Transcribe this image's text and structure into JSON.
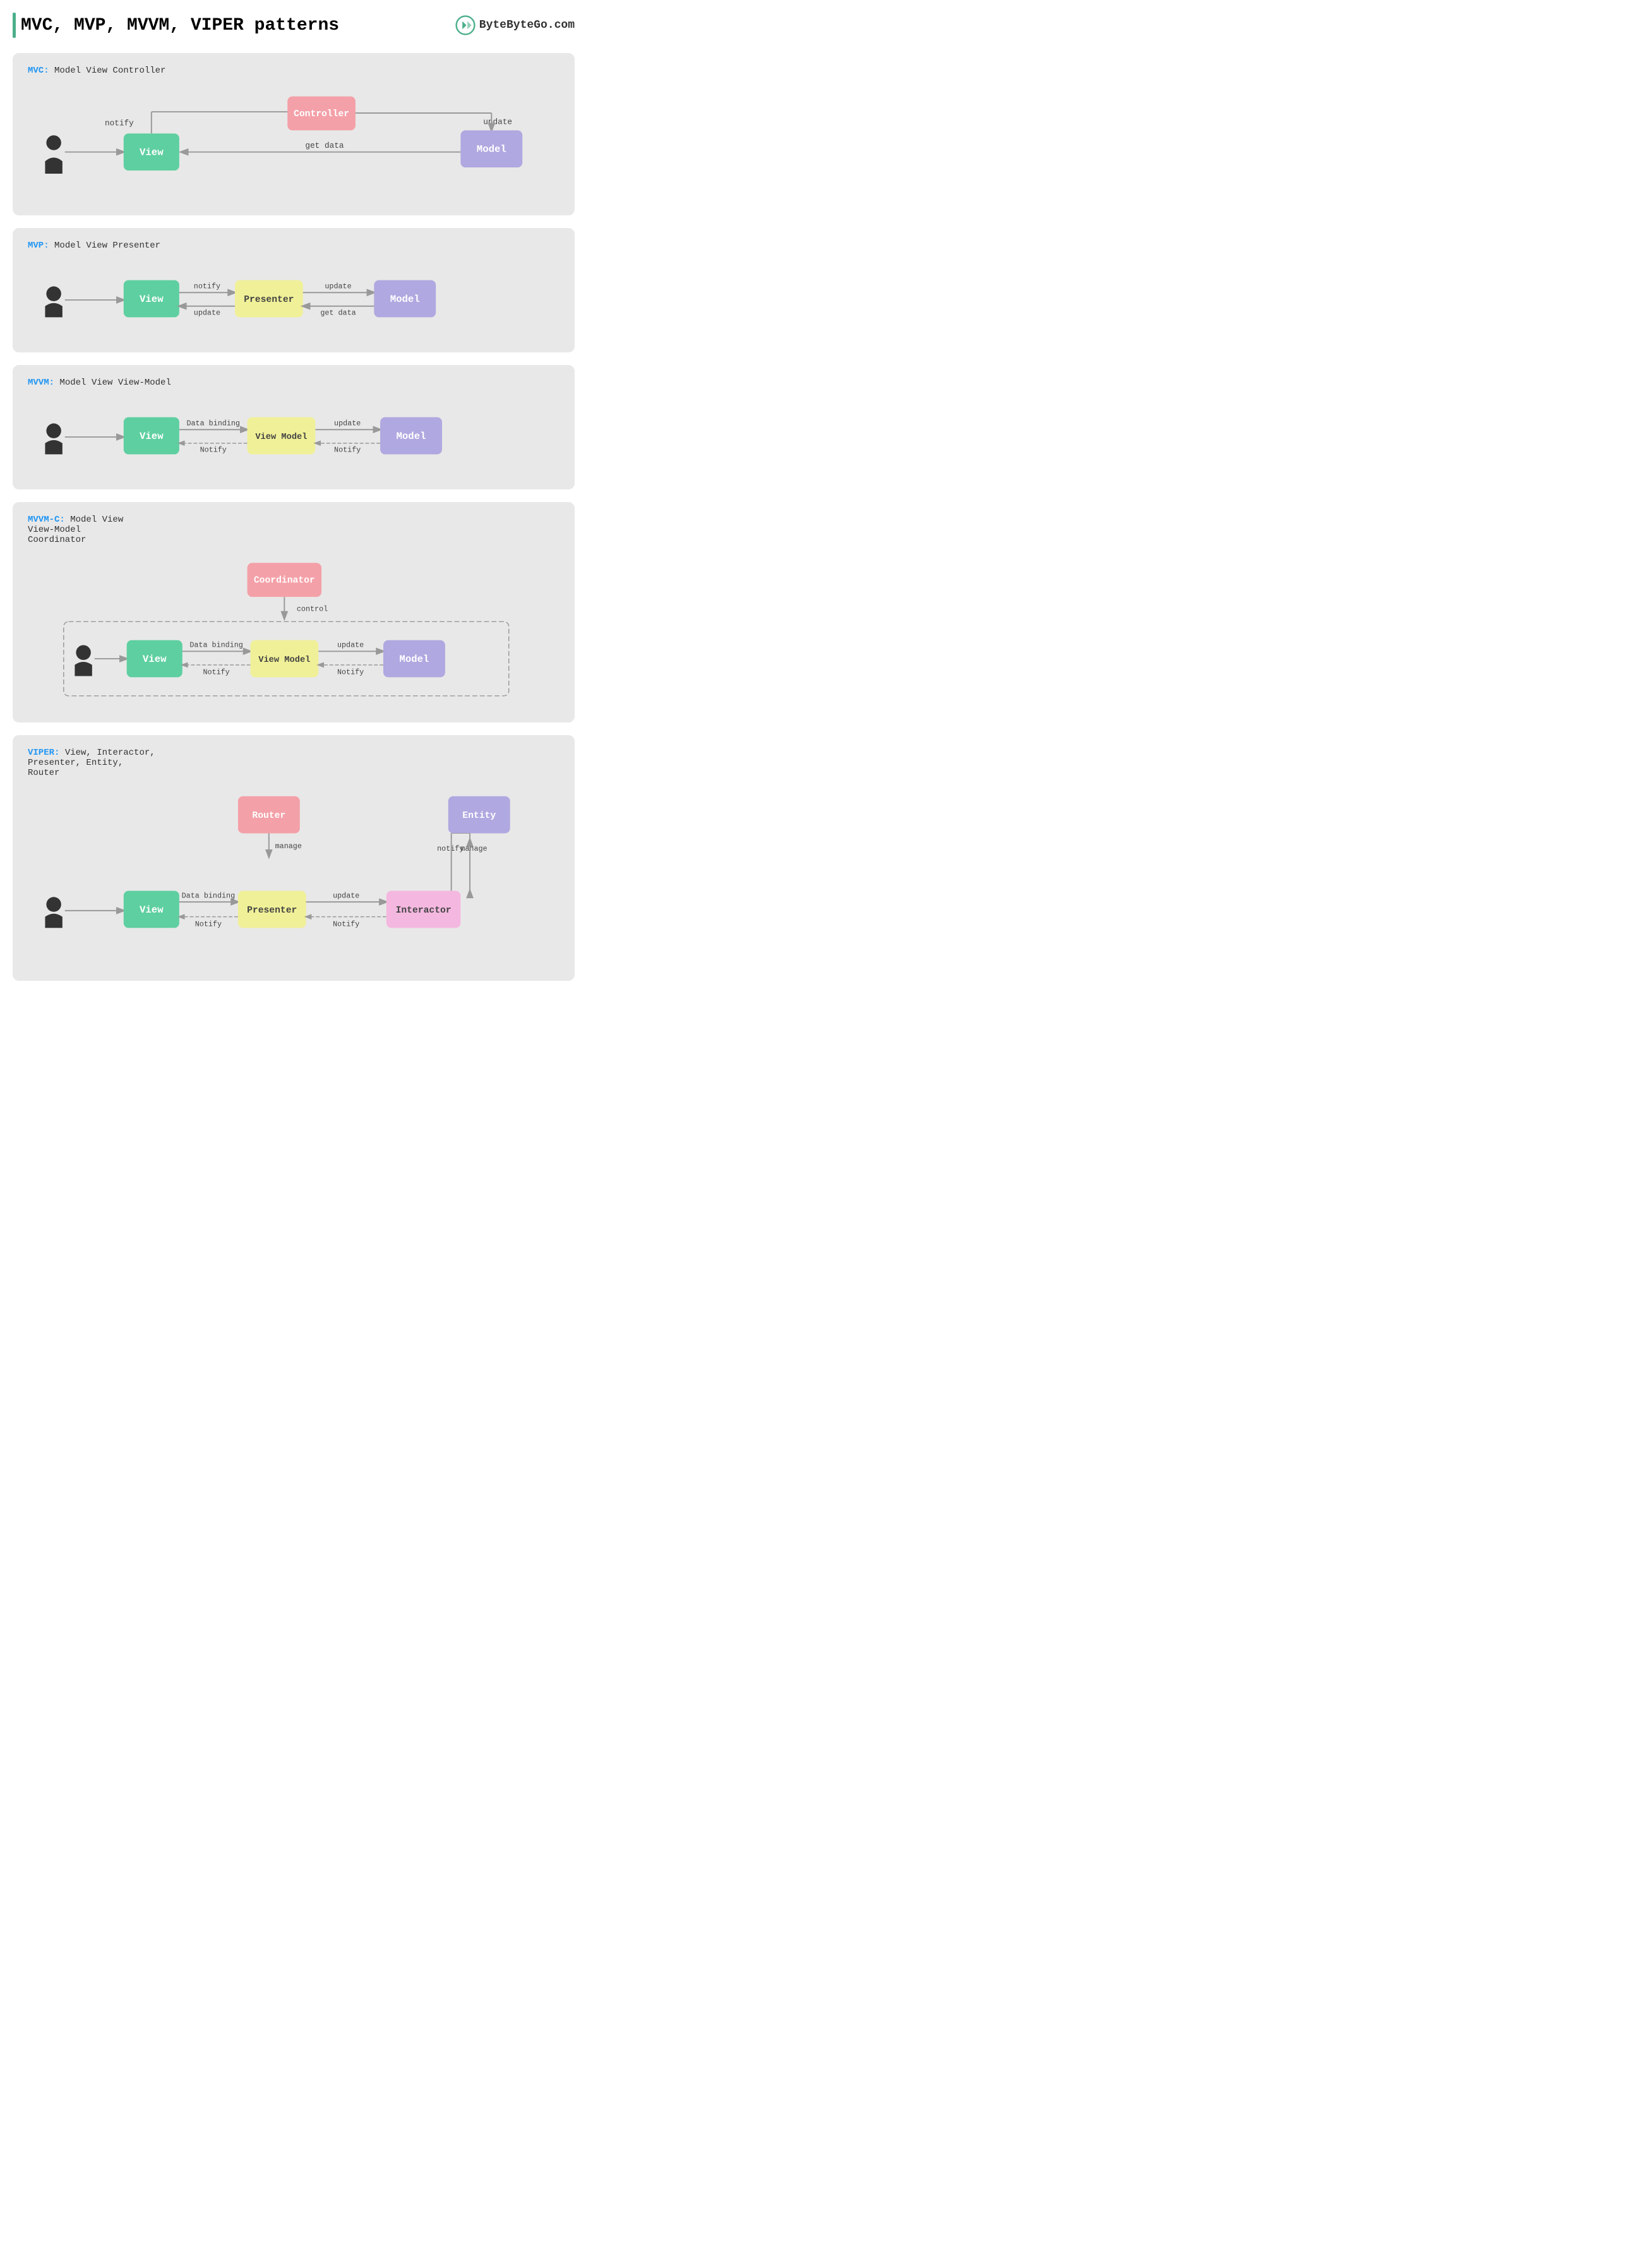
{
  "page": {
    "title": "MVC, MVP, MVVM, VIPER patterns",
    "brand": "ByteByteGo.com"
  },
  "patterns": {
    "mvc": {
      "key": "MVC:",
      "label": "Model View Controller",
      "controller": "Controller",
      "view": "View",
      "model": "Model",
      "arrows": {
        "user_to_view": "",
        "view_to_controller": "",
        "controller_to_model": "update",
        "model_to_view": "get data",
        "view_notify": "notify"
      }
    },
    "mvp": {
      "key": "MVP:",
      "label": "Model View Presenter",
      "view": "View",
      "presenter": "Presenter",
      "model": "Model",
      "arrows": {
        "notify": "notify",
        "update_vp": "update",
        "update_pm": "update",
        "get_data": "get data"
      }
    },
    "mvvm": {
      "key": "MVVM:",
      "label": "Model View View-Model",
      "view": "View",
      "viewmodel": "View Model",
      "model": "Model",
      "arrows": {
        "data_binding": "Data binding",
        "notify_vvm": "Notify",
        "update": "update",
        "notify_mv": "Notify"
      }
    },
    "mvvmc": {
      "key": "MVVM-C:",
      "label": "Model View\nView-Model\nCoordinator",
      "coordinator": "Coordinator",
      "view": "View",
      "viewmodel": "View Model",
      "model": "Model",
      "arrows": {
        "control": "control",
        "data_binding": "Data binding",
        "notify_vvm": "Notify",
        "update": "update",
        "notify_mv": "Notify"
      }
    },
    "viper": {
      "key": "VIPER:",
      "label": "View, Interactor,\nPresenter, Entity,\nRouter",
      "router": "Router",
      "entity": "Entity",
      "view": "View",
      "presenter": "Presenter",
      "interactor": "Interactor",
      "arrows": {
        "manage": "manage",
        "notify": "notify",
        "manage2": "manage",
        "data_binding": "Data binding",
        "notify_vp": "Notify",
        "update": "update",
        "notify_pi": "Notify"
      }
    }
  }
}
